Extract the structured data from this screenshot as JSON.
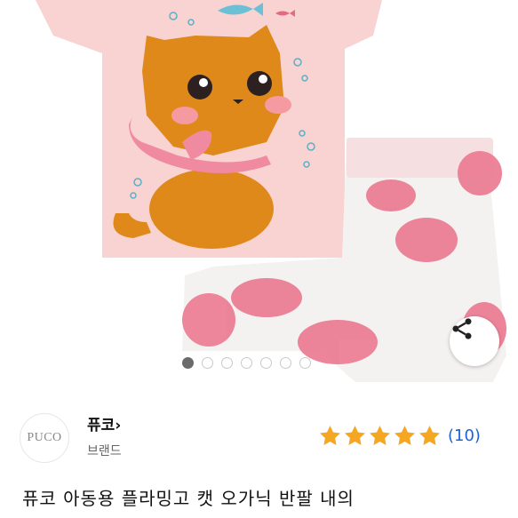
{
  "brand": {
    "logo_text": "PUCO",
    "name": "퓨코",
    "chevron": "›",
    "subtitle": "브랜드"
  },
  "rating": {
    "stars": 5,
    "max_stars": 5,
    "count_label": "(10)",
    "star_color": "#f5a623"
  },
  "product": {
    "title": "퓨코 아동용 플라밍고 캣 오가닉 반팔 내의"
  },
  "gallery": {
    "total_images": 7,
    "active_index": 0
  },
  "icons": {
    "share": "share-icon"
  }
}
